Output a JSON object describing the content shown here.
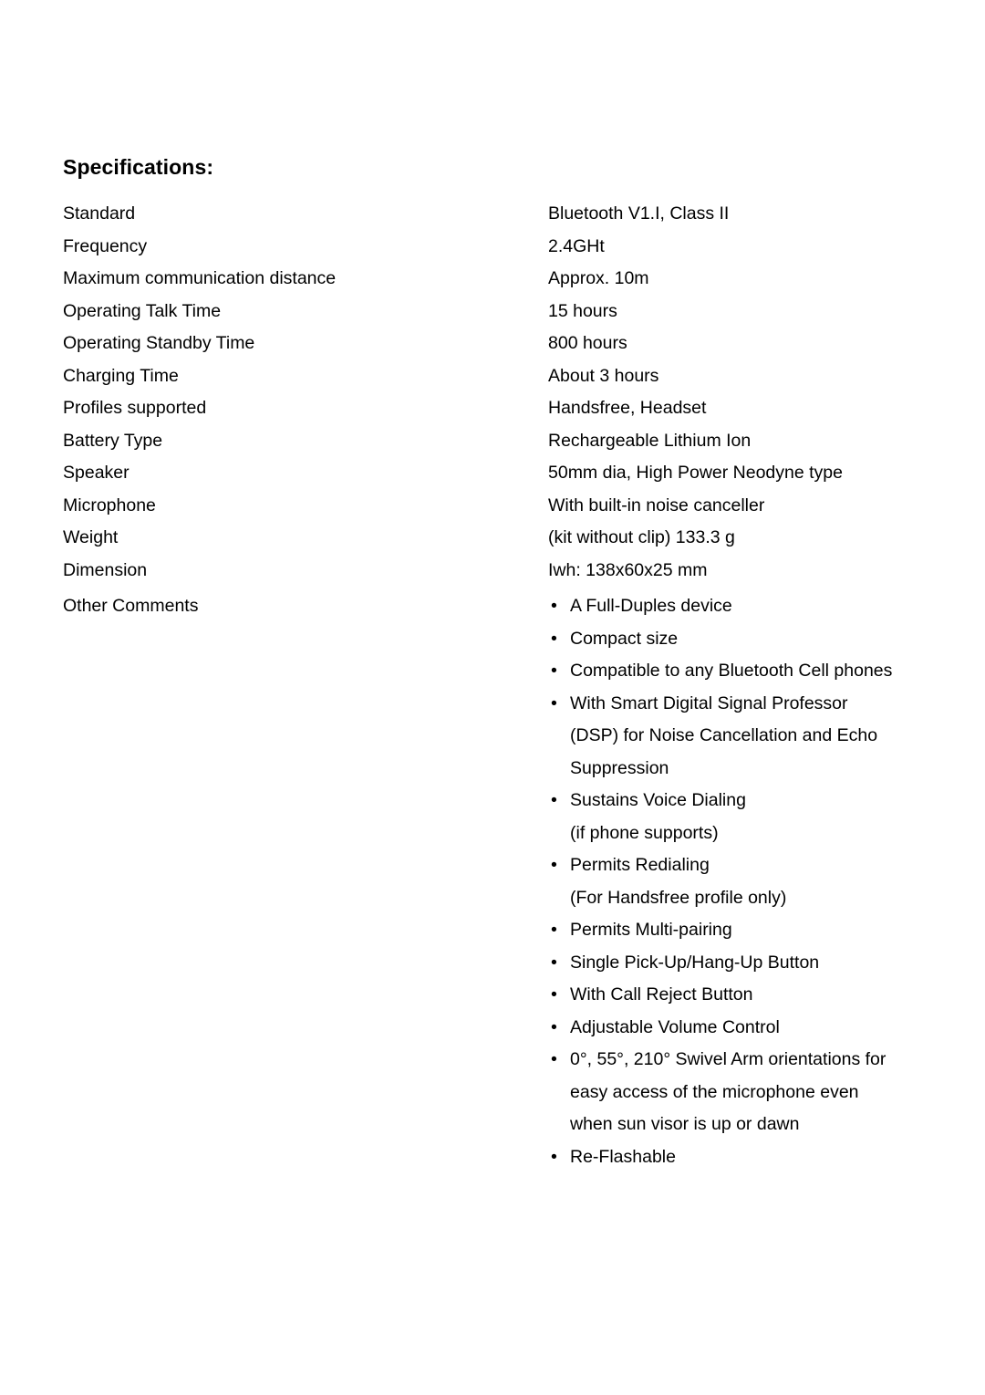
{
  "document": {
    "heading": "Specifications:"
  },
  "spec_rows": [
    {
      "label": "Standard",
      "value": "Bluetooth V1.I, Class II"
    },
    {
      "label": "Frequency",
      "value": "2.4GHt"
    },
    {
      "label": "Maximum communication distance",
      "value": "Approx. 10m"
    },
    {
      "label": "Operating Talk Time",
      "value": "15 hours"
    },
    {
      "label": "Operating Standby Time",
      "value": "800 hours"
    },
    {
      "label": "Charging Time",
      "value": "About 3 hours"
    },
    {
      "label": "Profiles supported",
      "value": "Handsfree, Headset"
    },
    {
      "label": "Battery Type",
      "value": "Rechargeable Lithium Ion"
    },
    {
      "label": "Speaker",
      "value": "50mm dia, High Power Neodyne type"
    },
    {
      "label": "Microphone",
      "value": "With built-in noise canceller"
    },
    {
      "label": "Weight",
      "value": "(kit without clip) 133.3 g"
    },
    {
      "label": "Dimension",
      "value": "Iwh: 138x60x25 mm"
    }
  ],
  "other_comments": {
    "label": "Other Comments",
    "bullet_glyph": "•",
    "items": [
      {
        "lines": [
          "A Full-Duples device"
        ]
      },
      {
        "lines": [
          "Compact size"
        ]
      },
      {
        "lines": [
          "Compatible to any Bluetooth Cell phones"
        ]
      },
      {
        "lines": [
          "With Smart Digital Signal Professor",
          "(DSP) for Noise Cancellation and Echo",
          "Suppression"
        ]
      },
      {
        "lines": [
          "Sustains Voice Dialing",
          "(if phone supports)"
        ]
      },
      {
        "lines": [
          "Permits Redialing",
          "(For Handsfree profile only)"
        ]
      },
      {
        "lines": [
          "Permits Multi-pairing"
        ]
      },
      {
        "lines": [
          "Single Pick-Up/Hang-Up Button"
        ]
      },
      {
        "lines": [
          "With Call Reject Button"
        ]
      },
      {
        "lines": [
          "Adjustable Volume Control"
        ]
      },
      {
        "lines": [
          "0°, 55°, 210° Swivel Arm orientations for",
          "easy access of the microphone even",
          "when sun visor is up or dawn"
        ]
      },
      {
        "lines": [
          "Re-Flashable"
        ]
      }
    ]
  },
  "colors": {
    "text": "#000000",
    "background": "#ffffff"
  }
}
